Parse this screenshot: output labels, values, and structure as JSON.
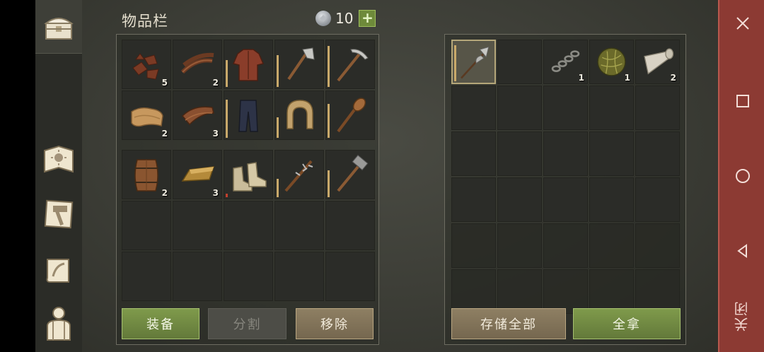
{
  "inventory": {
    "title": "物品栏",
    "currency_value": "10",
    "equipped_row1": [
      {
        "icon": "leather-scraps-icon",
        "qty": "5",
        "dura": null
      },
      {
        "icon": "leather-strips-icon",
        "qty": "2",
        "dura": null
      },
      {
        "icon": "leather-shirt-icon",
        "qty": "",
        "dura": 0.6
      },
      {
        "icon": "axe-icon",
        "qty": "",
        "dura": 0.7
      },
      {
        "icon": "pickaxe-icon",
        "qty": "",
        "dura": 0.9
      }
    ],
    "equipped_row2": [
      {
        "icon": "cloth-icon",
        "qty": "2",
        "dura": null
      },
      {
        "icon": "leather-piece-icon",
        "qty": "3",
        "dura": null
      },
      {
        "icon": "pants-icon",
        "qty": "",
        "dura": 0.85
      },
      {
        "icon": "hood-icon",
        "qty": "",
        "dura": 0.45
      },
      {
        "icon": "club-icon",
        "qty": "",
        "dura": 0.75
      }
    ],
    "backpack_row1": [
      {
        "icon": "barrel-icon",
        "qty": "2",
        "dura": null
      },
      {
        "icon": "ingot-icon",
        "qty": "3",
        "dura": null
      },
      {
        "icon": "boots-icon",
        "qty": "",
        "dura": 0.08,
        "red": true
      },
      {
        "icon": "spiked-club-icon",
        "qty": "",
        "dura": 0.4
      },
      {
        "icon": "hammer-icon",
        "qty": "",
        "dura": 0.6
      }
    ],
    "buttons": {
      "equip": "装备",
      "split": "分割",
      "remove": "移除"
    }
  },
  "storage": {
    "row1": [
      {
        "icon": "halberd-icon",
        "qty": "",
        "dura": 0.9,
        "selected": true
      },
      {
        "icon": "",
        "qty": ""
      },
      {
        "icon": "chain-icon",
        "qty": "1"
      },
      {
        "icon": "moss-ball-icon",
        "qty": "1"
      },
      {
        "icon": "cloth-roll-icon",
        "qty": "2"
      }
    ],
    "buttons": {
      "store_all": "存储全部",
      "take_all": "全拿"
    }
  },
  "navbar": {
    "close_label": "关闭"
  },
  "colors": {
    "accent_green": "#7f9a4b",
    "nav_red": "#8c3a33",
    "durability": "#c9a96a"
  }
}
